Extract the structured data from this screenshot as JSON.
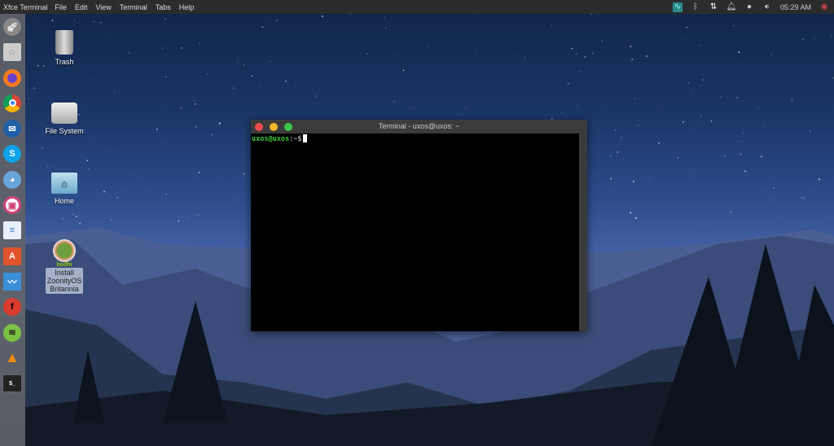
{
  "topbar": {
    "app": "Xfce Terminal",
    "menus": [
      "File",
      "Edit",
      "View",
      "Terminal",
      "Tabs",
      "Help"
    ],
    "clock": "05:29 AM"
  },
  "tray_icons": [
    "network-graph-icon",
    "bluetooth-icon",
    "transfer-arrows-icon",
    "bell-icon",
    "power-icon",
    "volume-icon"
  ],
  "dock": [
    "rocket-launcher-icon",
    "files-folder-icon",
    "firefox-icon",
    "chrome-icon",
    "thunderbird-icon",
    "skype-icon",
    "pidgin-icon",
    "image-viewer-icon",
    "text-editor-icon",
    "software-center-icon",
    "system-monitor-icon",
    "font-viewer-icon",
    "spotify-icon",
    "vlc-icon",
    "terminal-icon"
  ],
  "desktop": {
    "trash": "Trash",
    "filesystem": "File System",
    "home": "Home",
    "bodhi": "bodhi",
    "install": "Install ZoonityOS Britannia"
  },
  "terminal": {
    "title": "Terminal - uxos@uxos: ~",
    "user": "uxos@uxos",
    "path": ":~$",
    "colors": {
      "user": "#3ec93e"
    }
  }
}
